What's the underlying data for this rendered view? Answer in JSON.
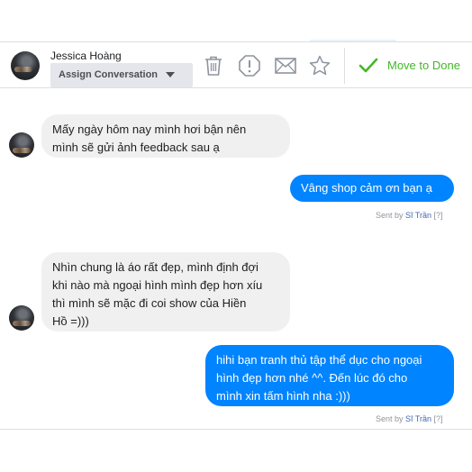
{
  "header": {
    "contact_name": "Jessica Hoàng",
    "assign_label": "Assign Conversation",
    "move_to_done_label": "Move to Done",
    "accent_color": "#42b72a"
  },
  "messages": [
    {
      "from": "customer",
      "text_lines": [
        "Mấy ngày hôm nay mình hơi bận nên",
        "mình sẽ gửi ảnh feedback sau ạ"
      ]
    },
    {
      "from": "page",
      "text_lines": [
        "Vâng shop cảm ơn bạn ạ"
      ],
      "sent_by_prefix": "Sent by ",
      "sent_by_name": "Sĩ Trần",
      "sent_by_suffix": " [?]"
    },
    {
      "from": "customer",
      "text_lines": [
        "Nhìn chung là áo rất đẹp, mình định đợi",
        "khi nào mà ngoại hình mình đẹp hơn xíu",
        "thì mình sẽ mặc đi coi show của Hiền",
        "Hồ =)))"
      ]
    },
    {
      "from": "page",
      "text_lines": [
        "hihi bạn tranh thủ tập thể dục cho ngoại",
        "hình đẹp hơn nhé ^^. Đến lúc đó cho",
        "mình xin tấm hình nha :)))"
      ],
      "sent_by_prefix": "Sent by ",
      "sent_by_name": "Sĩ Trần",
      "sent_by_suffix": " [?]"
    }
  ],
  "colors": {
    "outgoing_bubble": "#0084ff",
    "incoming_bubble": "#f1f0f0"
  },
  "icons": [
    "trash-icon",
    "block-icon",
    "mail-icon",
    "star-icon",
    "checkmark-icon"
  ]
}
